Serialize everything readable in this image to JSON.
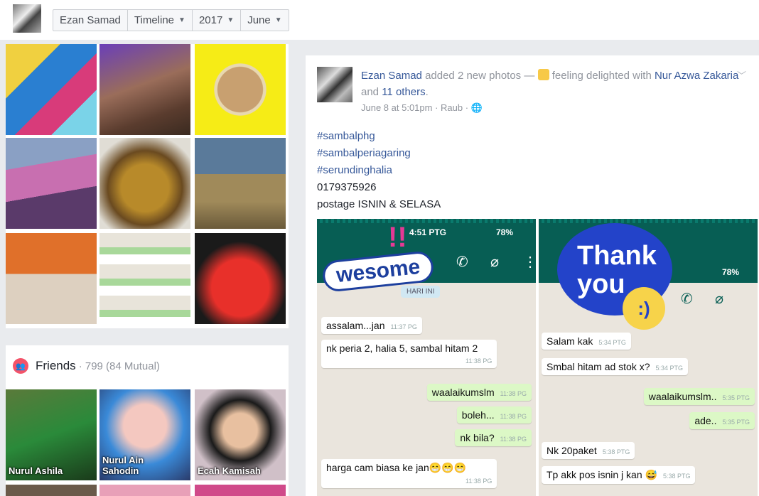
{
  "topbar": {
    "avatar_icon": "user-avatar",
    "crumbs": [
      {
        "label": "Ezan Samad",
        "dropdown": false
      },
      {
        "label": "Timeline",
        "dropdown": true
      },
      {
        "label": "2017",
        "dropdown": true
      },
      {
        "label": "June",
        "dropdown": true
      }
    ]
  },
  "photos_grid": {
    "tile_colors": [
      "#3b6fb0",
      "#7e5a4a",
      "#f2e21b",
      "#9aa3b8",
      "#8a6a2c",
      "#6d8a5a",
      "#c46a2c",
      "#a9c2a0",
      "#c0302a"
    ]
  },
  "friends": {
    "title": "Friends",
    "count": "· 799 (84 Mutual)",
    "items": [
      {
        "name": "Nurul Ashila"
      },
      {
        "name": "Nurul Ain Sahodin"
      },
      {
        "name": "Ecah Kamisah"
      }
    ]
  },
  "post": {
    "author": "Ezan Samad",
    "action": "added 2 new photos —",
    "feeling": "feeling delighted with",
    "with_name": "Nur Azwa Zakaria",
    "and_text": "and",
    "others": "11 others",
    "date": "June 8 at 5:01pm",
    "location": "Raub",
    "text_lines": [
      "#sambalphg",
      "#sambalperiagaring",
      "#serundinghalia",
      "0179375926",
      "postage ISNIN & SELASA"
    ],
    "shot1": {
      "status_time": "4:51 PTG",
      "battery": "78%",
      "sticker_text": "wesome",
      "sticker_bang": "!!",
      "date_chip": "HARI INI",
      "messages": [
        {
          "text": "assalam...jan",
          "time": "11:37 PG",
          "dir": "in"
        },
        {
          "text": "nk peria 2, halia 5, sambal hitam 2",
          "time": "11:38 PG",
          "dir": "in"
        },
        {
          "text": "waalaikumslm",
          "time": "11:38 PG",
          "dir": "out"
        },
        {
          "text": "boleh...",
          "time": "11:38 PG",
          "dir": "out"
        },
        {
          "text": "nk bila?",
          "time": "11:38 PG",
          "dir": "out"
        },
        {
          "text": "harga cam biasa ke jan😁😁😁",
          "time": "11:38 PG",
          "dir": "in"
        }
      ]
    },
    "shot2": {
      "battery": "78%",
      "sticker_line1": "Thank",
      "sticker_line2": "you",
      "messages": [
        {
          "text": "Salam kak",
          "time": "5:34 PTG",
          "dir": "in"
        },
        {
          "text": "Smbal hitam ad stok x?",
          "time": "5:34 PTG",
          "dir": "in"
        },
        {
          "text": "waalaikumslm..",
          "time": "5:35 PTG",
          "dir": "out"
        },
        {
          "text": "ade..",
          "time": "5:35 PTG",
          "dir": "out"
        },
        {
          "text": "Nk 20paket",
          "time": "5:38 PTG",
          "dir": "in"
        },
        {
          "text": "Tp akk pos isnin j kan 😅",
          "time": "5:38 PTG",
          "dir": "in"
        }
      ]
    }
  }
}
